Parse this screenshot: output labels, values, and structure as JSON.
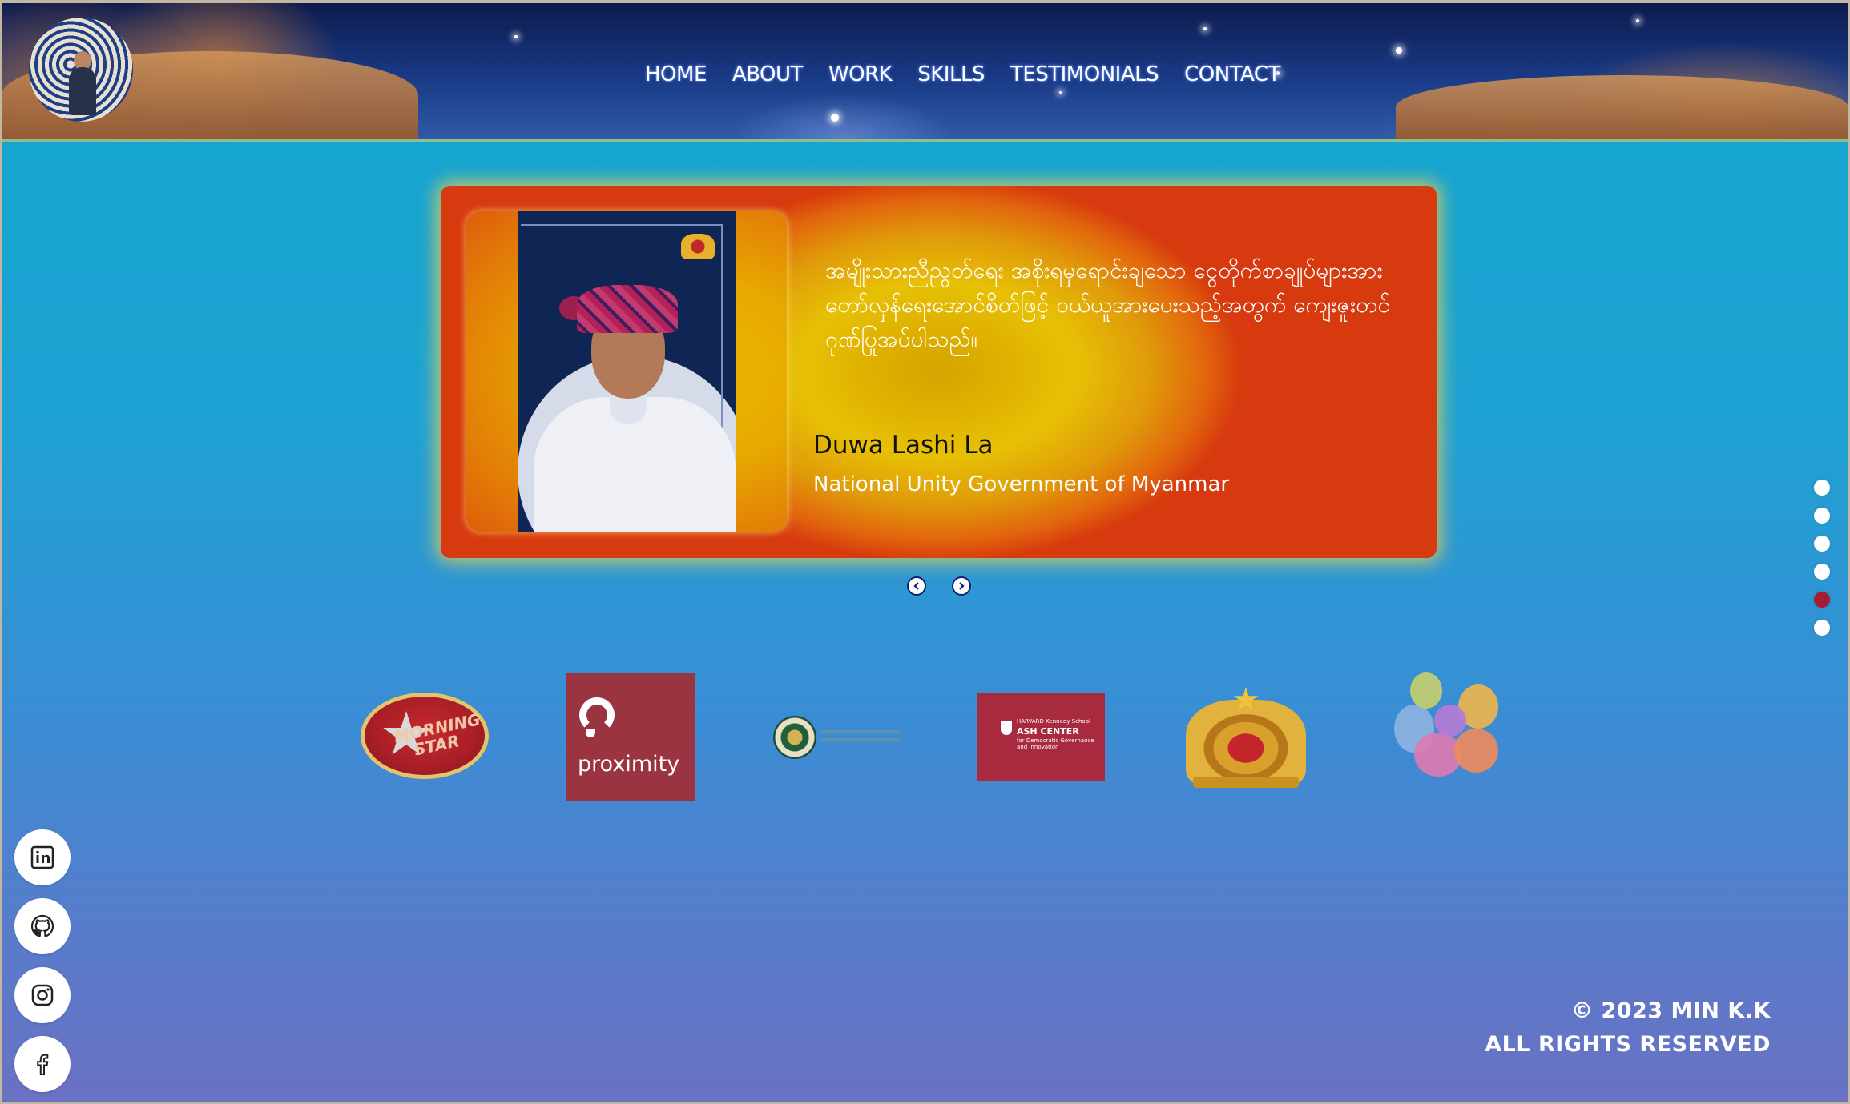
{
  "nav": {
    "items": [
      {
        "label": "HOME"
      },
      {
        "label": "ABOUT"
      },
      {
        "label": "WORK"
      },
      {
        "label": "SKILLS"
      },
      {
        "label": "TESTIMONIALS"
      },
      {
        "label": "CONTACT"
      }
    ]
  },
  "testimonial": {
    "quote": "အမျိုးသားညီညွတ်ရေး အစိုးရမှရောင်းချသော ငွေတိုက်စာချုပ်များအား တော်လှန်ရေးအောင်စိတ်ဖြင့် ဝယ်ယူအားပေးသည့်အတွက် ကျေးဇူးတင်ဂုဏ်ပြုအပ်ပါသည်။",
    "author_name": "Duwa Lashi La",
    "author_org": "National Unity Government of Myanmar",
    "prev_icon": "chevron-left-icon",
    "next_icon": "chevron-right-icon"
  },
  "section_dots": {
    "count": 6,
    "active_index": 4,
    "active_color": "#a31d34"
  },
  "clients": {
    "morning_star_text": "MORNING STAR",
    "proximity_text": "proximity",
    "ash_center_small": "HARVARD Kennedy School",
    "ash_center_title": "ASH CENTER",
    "ash_center_sub": "for Democratic Governance and Innovation"
  },
  "social": [
    {
      "icon": "linkedin-icon"
    },
    {
      "icon": "github-icon"
    },
    {
      "icon": "instagram-icon"
    },
    {
      "icon": "facebook-icon"
    }
  ],
  "footer": {
    "copyright": "© 2023 MIN K.K",
    "rights": "ALL RIGHTS RESERVED"
  },
  "colors": {
    "background_top": "#12a6cf",
    "background_bottom": "#6a71c3",
    "card_core": "#e7c105",
    "card_edge": "#d63a0e"
  }
}
